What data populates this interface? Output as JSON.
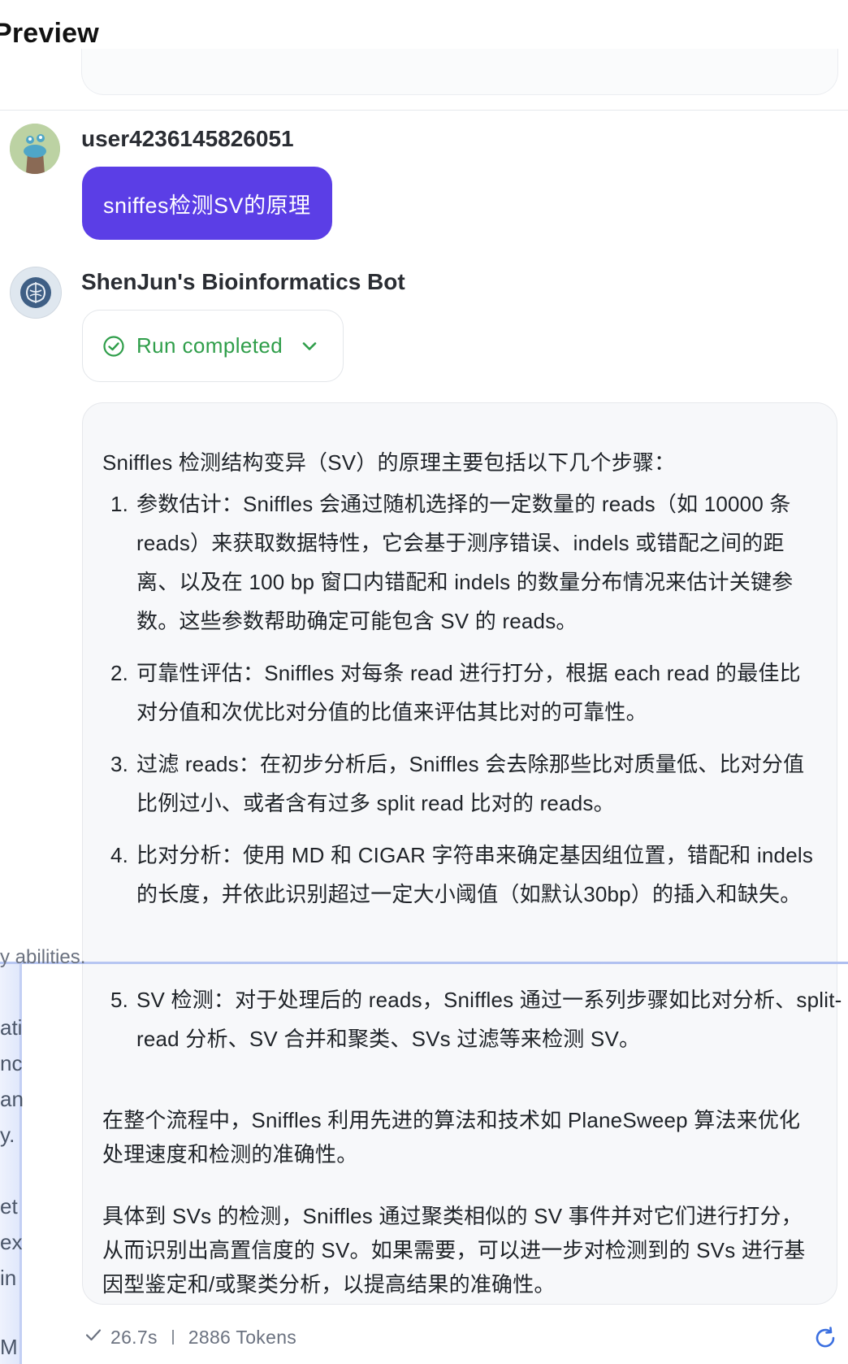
{
  "header": {
    "title": "Preview"
  },
  "user_message": {
    "sender": "user4236145826051",
    "text": "sniffes检测SV的原理"
  },
  "bot_message": {
    "sender": "ShenJun's Bioinformatics Bot",
    "run_status": "Run completed",
    "intro": "Sniffles 检测结构变异（SV）的原理主要包括以下几个步骤：",
    "steps": [
      {
        "num": "1.",
        "text": "参数估计：Sniffles 会通过随机选择的一定数量的 reads（如 10000 条 reads）来获取数据特性，它会基于测序错误、indels 或错配之间的距离、以及在 100 bp 窗口内错配和 indels 的数量分布情况来估计关键参数。这些参数帮助确定可能包含 SV 的 reads。"
      },
      {
        "num": "2.",
        "text": "可靠性评估：Sniffles 对每条 read 进行打分，根据 each read 的最佳比对分值和次优比对分值的比值来评估其比对的可靠性。"
      },
      {
        "num": "3.",
        "text": "过滤 reads：在初步分析后，Sniffles 会去除那些比对质量低、比对分值比例过小、或者含有过多 split read 比对的 reads。"
      },
      {
        "num": "4.",
        "text": "比对分析：使用 MD 和 CIGAR 字符串来确定基因组位置，错配和 indels 的长度，并依此识别超过一定大小阈值（如默认30bp）的插入和缺失。"
      },
      {
        "num": "5.",
        "text": "SV 检测：对于处理后的 reads，Sniffles 通过一系列步骤如比对分析、split-read 分析、SV 合并和聚类、SVs 过滤等来检测 SV。"
      }
    ],
    "para2": "在整个流程中，Sniffles 利用先进的算法和技术如 PlaneSweep 算法来优化处理速度和检测的准确性。",
    "para3": "具体到 SVs 的检测，Sniffles 通过聚类相似的 SV 事件并对它们进行打分，从而识别出高置信度的 SV。如果需要，可以进一步对检测到的 SVs 进行基因型鉴定和/或聚类分析，以提高结果的准确性。",
    "meta": {
      "time": "26.7s",
      "tokens": "2886 Tokens"
    }
  },
  "overlay_fragments": [
    "y abilities.",
    "ati",
    "nc",
    "an",
    "y.",
    "et",
    "ex",
    "in",
    "M"
  ],
  "colors": {
    "accent": "#5b3ee6",
    "success": "#2f9e4a",
    "refresh": "#3b6fe0"
  }
}
